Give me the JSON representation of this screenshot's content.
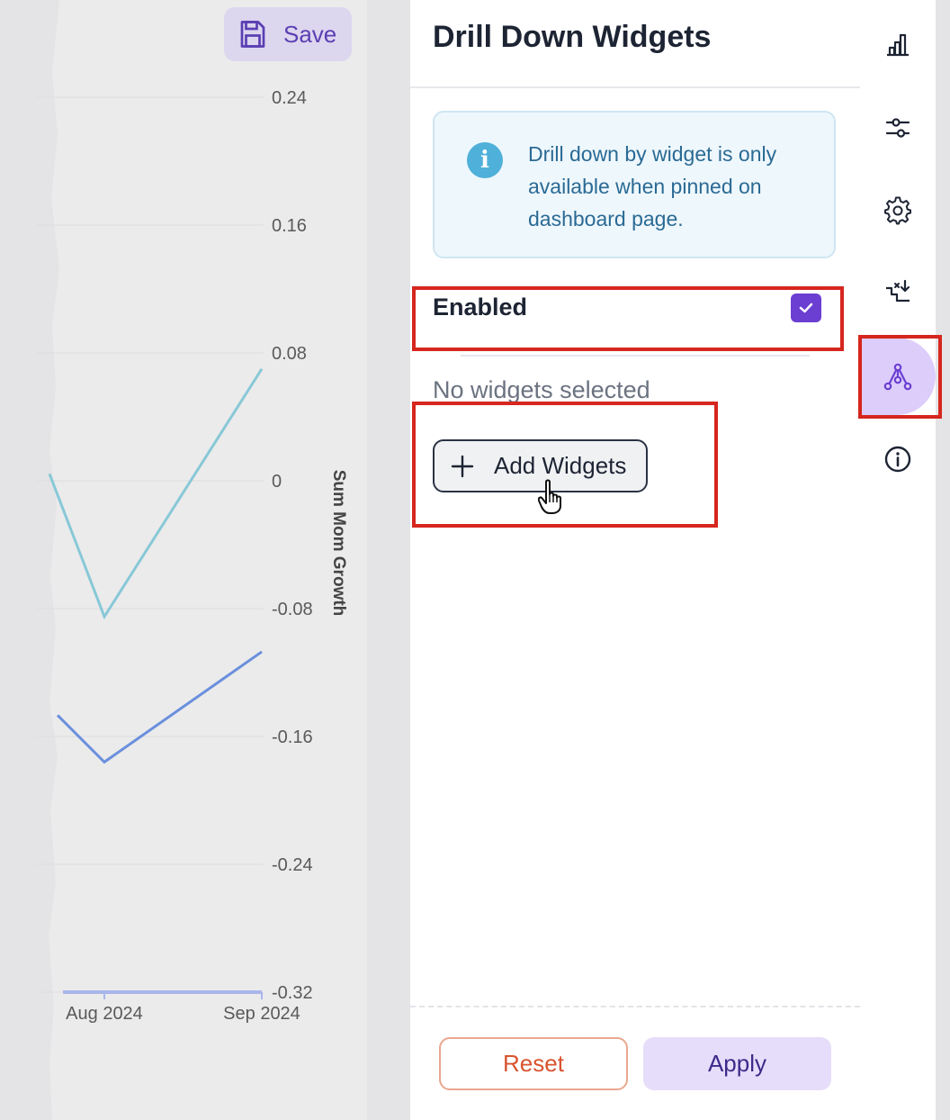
{
  "toolbar": {
    "save_label": "Save",
    "save_icon": "floppy-disk-icon"
  },
  "chart_data": {
    "type": "line",
    "ylabel": "Sum Mom Growth",
    "ylim": [
      -0.32,
      0.24
    ],
    "y_ticks": [
      "0.24",
      "0.16",
      "0.08",
      "0",
      "-0.08",
      "-0.16",
      "-0.24",
      "-0.32"
    ],
    "x_ticks": [
      "Aug 2024",
      "Sep 2024"
    ],
    "grid": true,
    "series": [
      {
        "color": "#88c8d6",
        "points": [
          {
            "x": "Aug 2024",
            "y": -0.085
          },
          {
            "x": "Sep 2024",
            "y": 0.07
          }
        ]
      },
      {
        "color": "#6a8fdc",
        "points": [
          {
            "x": "Aug 2024",
            "y": -0.176
          },
          {
            "x": "Sep 2024",
            "y": -0.107
          }
        ]
      },
      {
        "color": "#a9b6ea",
        "points": [
          {
            "x": "Aug 2024",
            "y": -0.32
          },
          {
            "x": "Sep 2024",
            "y": -0.32
          }
        ]
      }
    ]
  },
  "drawer": {
    "title": "Drill Down Widgets",
    "info_text": "Drill down by widget is only available when pinned on dashboard page.",
    "enabled_label": "Enabled",
    "enabled_checked": true,
    "empty_text": "No widgets selected",
    "add_label": "Add Widgets",
    "reset_label": "Reset",
    "apply_label": "Apply"
  },
  "rail": {
    "items": [
      {
        "icon": "bar-chart-icon",
        "active": false
      },
      {
        "icon": "sliders-icon",
        "active": false
      },
      {
        "icon": "gear-icon",
        "active": false
      },
      {
        "icon": "drill-down-arrow-icon",
        "active": false
      },
      {
        "icon": "tree-hierarchy-icon",
        "active": true
      },
      {
        "icon": "info-circle-icon",
        "active": false
      }
    ]
  },
  "colors": {
    "accent": "#6b3fd1",
    "highlight": "#d6261e",
    "reset": "#d8542f"
  }
}
